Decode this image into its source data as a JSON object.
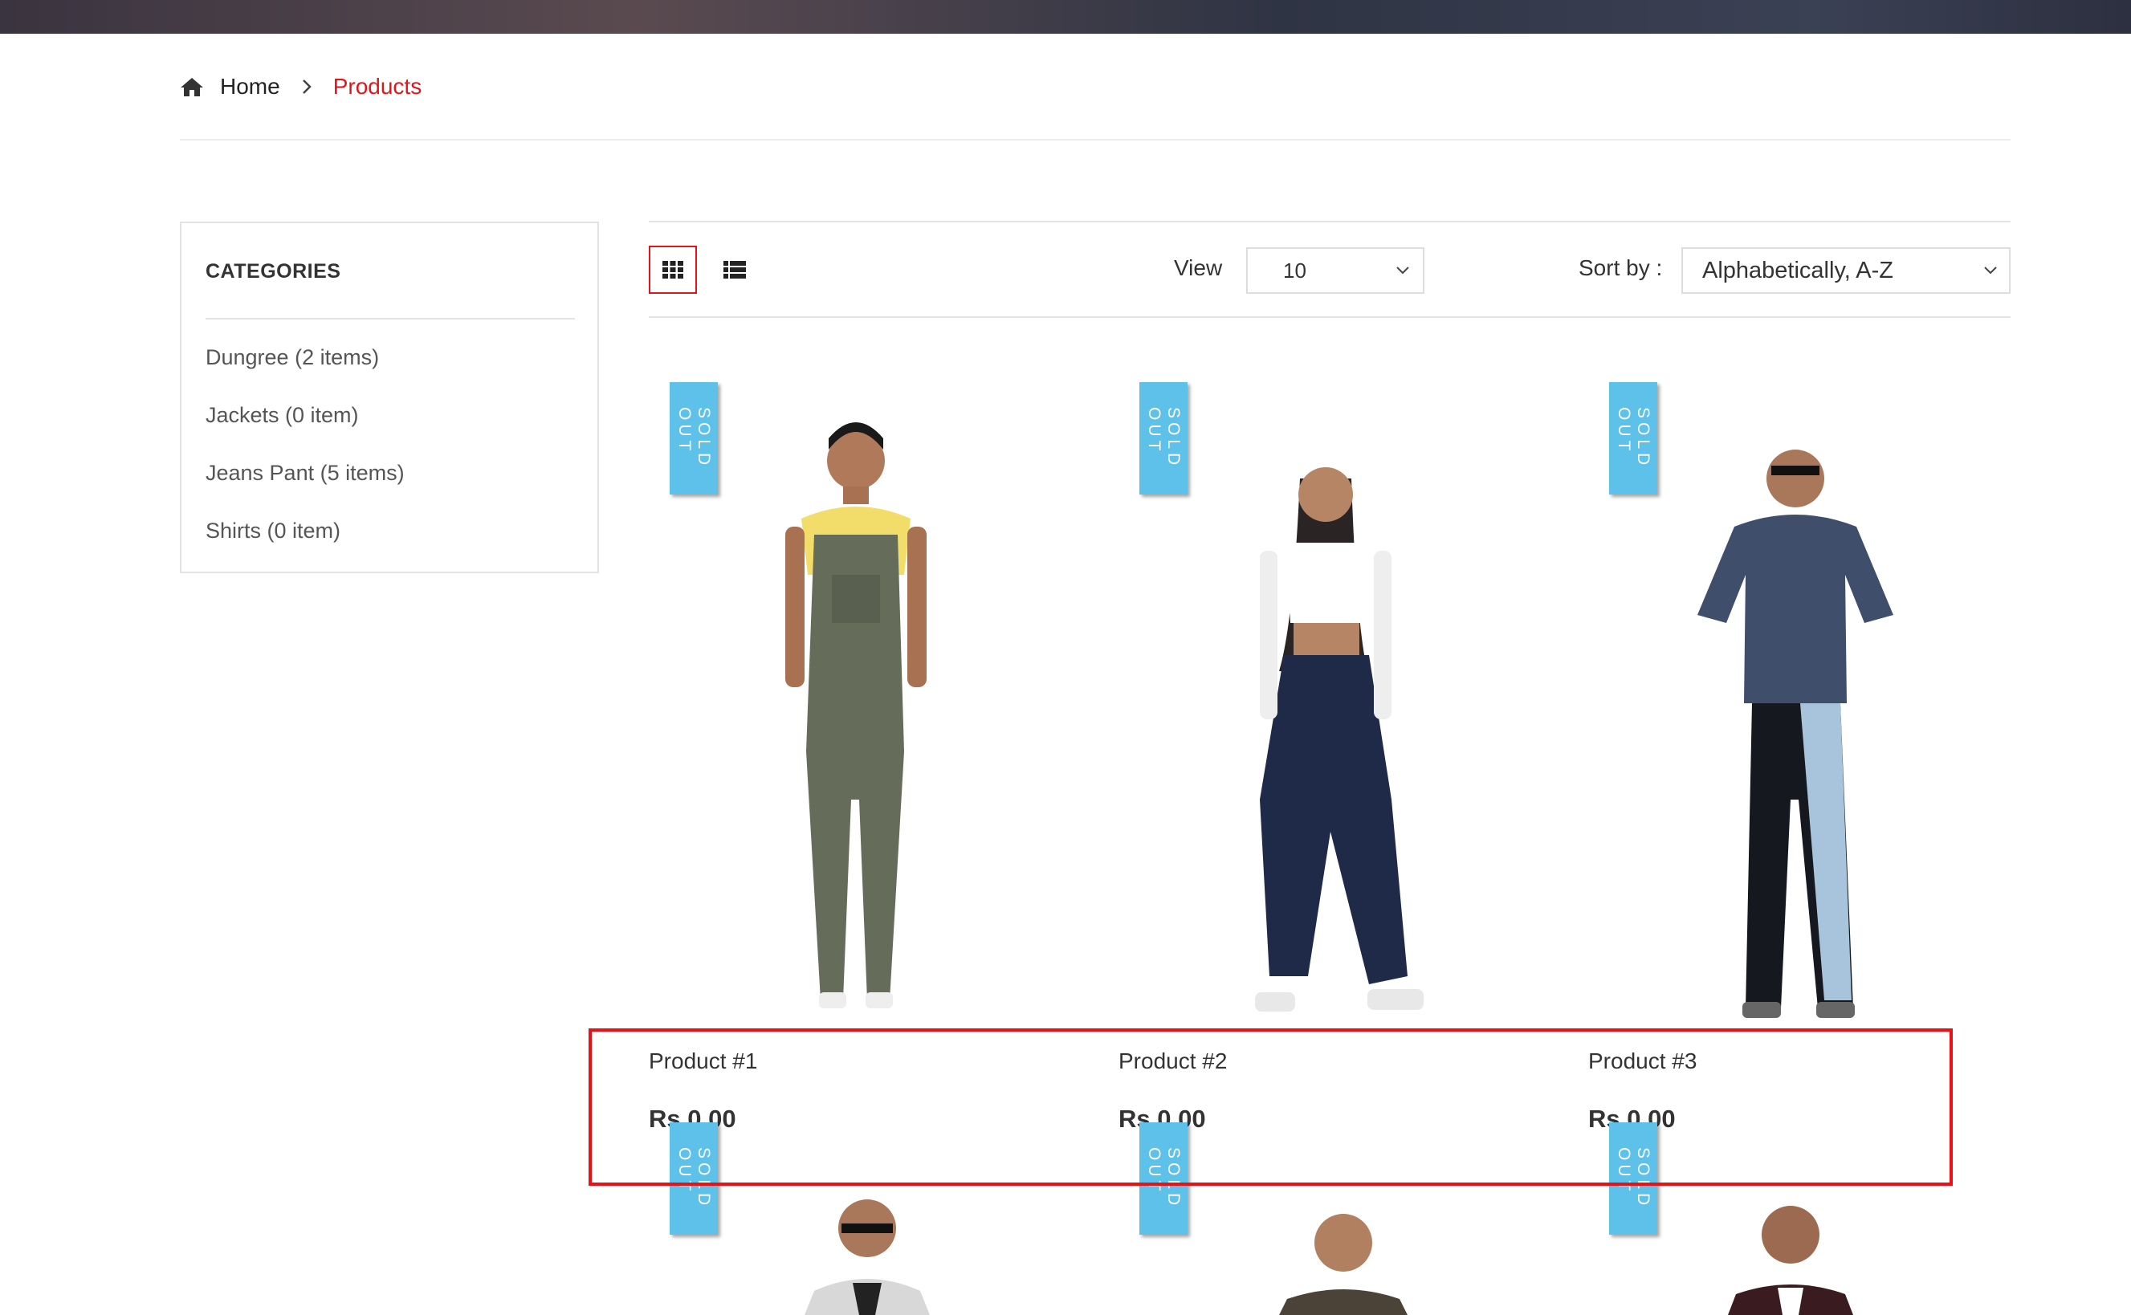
{
  "breadcrumb": {
    "home_icon": "home-icon",
    "home": "Home",
    "separator_icon": "chevron-right-icon",
    "current": "Products"
  },
  "sidebar": {
    "title": "CATEGORIES",
    "items": [
      {
        "label": "Dungree (2 items)"
      },
      {
        "label": "Jackets (0 item)"
      },
      {
        "label": "Jeans Pant (5 items)"
      },
      {
        "label": "Shirts (0 item)"
      }
    ]
  },
  "toolbar": {
    "grid_icon": "grid-view-icon",
    "list_icon": "list-view-icon",
    "view_label": "View",
    "view_value": "10",
    "sort_label": "Sort by :",
    "sort_value": "Alphabetically, A-Z"
  },
  "products": [
    {
      "name": "Product #1",
      "price": "Rs 0.00",
      "badge": "SOLD\nOUT"
    },
    {
      "name": "Product #2",
      "price": "Rs 0.00",
      "badge": "SOLD\nOUT"
    },
    {
      "name": "Product #3",
      "price": "Rs 0.00",
      "badge": "SOLD\nOUT"
    }
  ],
  "products_row2": [
    {
      "badge": "SOLD\nOUT"
    },
    {
      "badge": "SOLD\nOUT"
    },
    {
      "badge": "SOLD\nOUT"
    }
  ],
  "colors": {
    "accent": "#e0161b",
    "badge": "#5ec1ea",
    "highlight": "#ee0f14"
  }
}
